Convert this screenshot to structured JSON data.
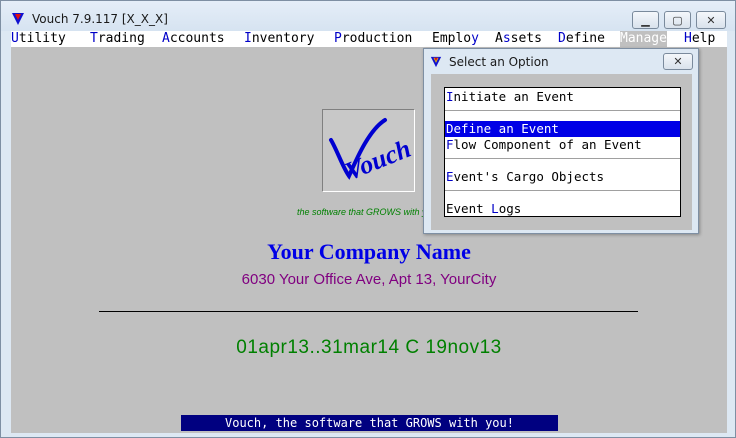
{
  "window": {
    "title": "Vouch  7.9.117  [X_X_X]",
    "icon": "vouch-triangle-icon",
    "controls": {
      "minimize": "▁",
      "maximize": "▢",
      "close": "✕"
    }
  },
  "menu": {
    "items": [
      {
        "hot": "U",
        "rest": "tility"
      },
      {
        "hot": "T",
        "rest": "rading"
      },
      {
        "hot": "A",
        "rest": "ccounts"
      },
      {
        "hot": "I",
        "rest": "nventory"
      },
      {
        "hot": "P",
        "rest": "roduction"
      },
      {
        "pre": "Emplo",
        "hot": "y",
        "rest": ""
      },
      {
        "pre": "A",
        "hot": "s",
        "rest": "sets"
      },
      {
        "hot": "D",
        "rest": "efine"
      },
      {
        "hot": "M",
        "rest": "anage",
        "active": true
      },
      {
        "hot": "H",
        "rest": "elp"
      }
    ]
  },
  "main": {
    "logo_text": "Vouch",
    "tagline_small": "the software that GROWS with you",
    "company_name": "Your Company Name",
    "company_address": "6030 Your Office Ave, Apt 13, YourCity",
    "period": "01apr13..31mar14  C  19nov13",
    "footer_banner": "Vouch, the software that GROWS with you!"
  },
  "dialog": {
    "title": "Select an Option",
    "close_label": "✕",
    "options": [
      {
        "hot": "I",
        "rest": "nitiate an Event",
        "selected": false
      },
      {
        "hot": "D",
        "rest": "efine an Event",
        "selected": true
      },
      {
        "hot": "F",
        "rest": "low Component of an Event",
        "selected": false
      },
      {
        "hot": "E",
        "rest": "vent's Cargo Objects",
        "selected": false
      },
      {
        "pre": "Event ",
        "hot": "L",
        "rest": "ogs",
        "selected": false
      }
    ]
  },
  "colors": {
    "menu_hotkey": "#0000c8",
    "selection": "#0000e6",
    "company_name": "#0000e6",
    "address": "#800080",
    "period": "#008000",
    "banner_bg": "#000080"
  }
}
